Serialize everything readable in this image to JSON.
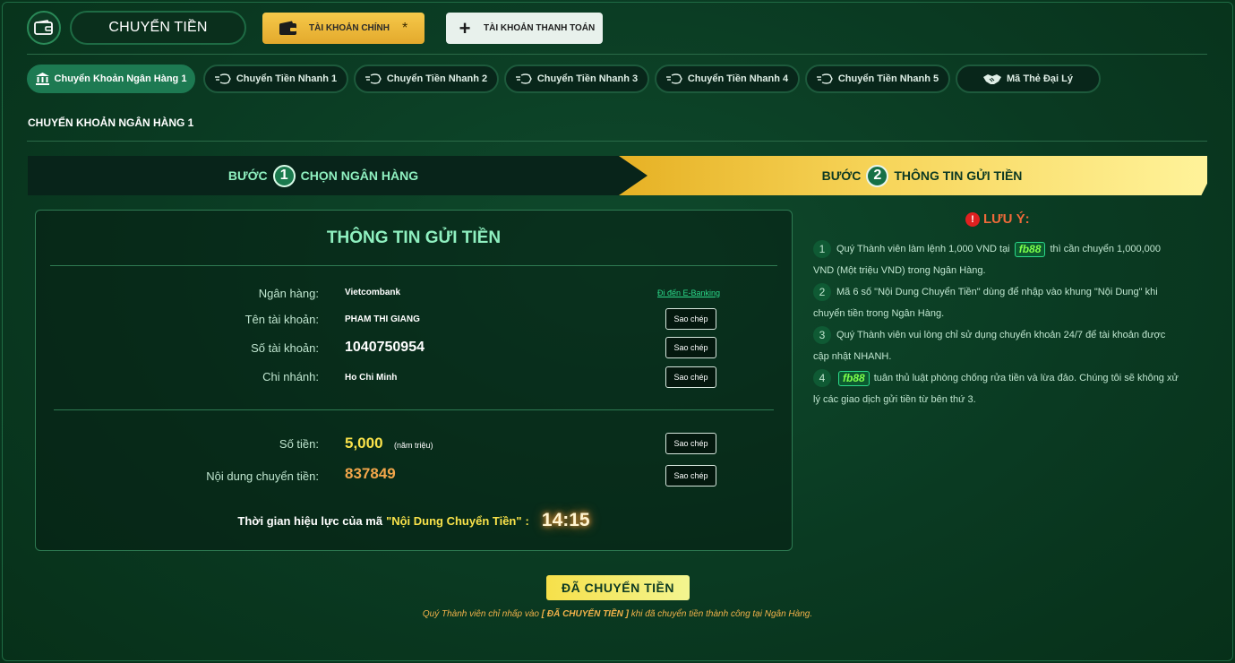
{
  "header": {
    "title": "CHUYỂN TIỀN",
    "main_account": "TÀI KHOẢN CHÍNH",
    "main_account_mark": "*",
    "payment_account": "TÀI KHOẢN THANH TOÁN"
  },
  "tabs": [
    {
      "label": "Chuyển Khoản Ngân Hàng 1",
      "icon": "bank-icon",
      "active": true
    },
    {
      "label": "Chuyển Tiền Nhanh 1",
      "icon": "fast-transfer-icon"
    },
    {
      "label": "Chuyển Tiền Nhanh 2",
      "icon": "fast-transfer-icon"
    },
    {
      "label": "Chuyển Tiền Nhanh 3",
      "icon": "fast-transfer-icon"
    },
    {
      "label": "Chuyển Tiền Nhanh 4",
      "icon": "fast-transfer-icon"
    },
    {
      "label": "Chuyển Tiền Nhanh 5",
      "icon": "fast-transfer-icon"
    },
    {
      "label": "Mã Thẻ Đại Lý",
      "icon": "handshake-icon"
    }
  ],
  "section_title": "CHUYỂN KHOẢN NGÂN HÀNG 1",
  "steps": {
    "step1": {
      "prefix": "BƯỚC",
      "number": "1",
      "label": "CHỌN NGÂN HÀNG"
    },
    "step2": {
      "prefix": "BƯỚC",
      "number": "2",
      "label": "THÔNG TIN GỬI TIỀN"
    }
  },
  "panel": {
    "title": "THÔNG TIN GỬI TIỀN",
    "bank_label": "Ngân hàng:",
    "bank_value": "Vietcombank",
    "ebanking_link": "Đi đến E-Banking",
    "account_name_label": "Tên tài khoản:",
    "account_name_value": "PHAM THI GIANG",
    "account_number_label": "Số tài khoản:",
    "account_number_value": "1040750954",
    "branch_label": "Chi nhánh:",
    "branch_value": "Ho Chi Minh",
    "amount_label": "Số tiền:",
    "amount_value": "5,000",
    "amount_words": "(năm triệu)",
    "content_label": "Nội dung chuyển tiền:",
    "content_value": "837849",
    "copy_label": "Sao chép",
    "validity_prefix": "Thời gian hiệu lực của mã",
    "validity_quote": "\"Nội Dung Chuyển Tiền\"",
    "validity_suffix": ":",
    "timer": "14:15"
  },
  "notes": {
    "title": "LƯU Ý:",
    "warn_mark": "!",
    "brand": "fb88",
    "items": [
      {
        "number": "1",
        "before": "Quý Thành viên làm lệnh 1,000 VND tại",
        "after": "thì cần chuyển 1,000,000 VND (Một triệu VND) trong Ngân Hàng."
      },
      {
        "number": "2",
        "text": "Mã 6 số \"Nội Dung Chuyển Tiền\" dùng để nhập vào khung \"Nội Dung\" khi chuyển tiền trong Ngân Hàng."
      },
      {
        "number": "3",
        "text": "Quý Thành viên vui lòng chỉ sử dụng chuyển khoản 24/7 để tài khoản được cập nhật NHANH."
      },
      {
        "number": "4",
        "after": "tuân thủ luật phòng chống rửa tiền và lừa đảo. Chúng tôi sẽ không xử lý các giao dịch gửi tiền từ bên thứ 3."
      }
    ]
  },
  "done_button": "ĐÃ CHUYỂN TIỀN",
  "footnote": {
    "before": "Quý Thành viên chỉ nhấp vào",
    "highlight": "[ ĐÃ CHUYỂN TIỀN ]",
    "after": "khi đã chuyển tiền thành công tại Ngân Hàng."
  },
  "colors": {
    "accent": "#8ff0c0",
    "gold": "#f6c94a",
    "background": "#0a3a22"
  }
}
